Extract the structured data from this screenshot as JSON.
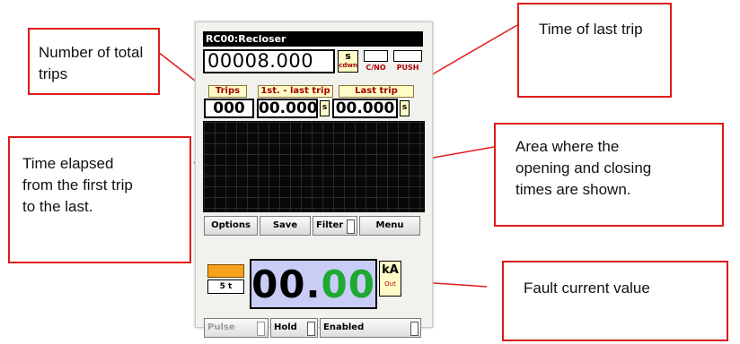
{
  "device": {
    "title": "RC00:Recloser",
    "counter_value": "00008.000",
    "counter_unit": "s",
    "counter_mode": "cdwn",
    "checkbox_labels": [
      "C/NO",
      "PUSH"
    ],
    "headers": {
      "trips": "Trips",
      "first_last": "1st. - last trip",
      "last": "Last trip"
    },
    "values": {
      "trips": "000",
      "first_last": "00.000",
      "first_last_unit": "s",
      "last": "00.000",
      "last_unit": "s"
    },
    "buttons": {
      "options": "Options",
      "save": "Save",
      "filter": "Filter",
      "menu": "Menu"
    },
    "small_value": "5 t",
    "current_digits": {
      "int": "00",
      "dot": ".",
      "frac": "00"
    },
    "current_unit": "kA",
    "current_sub": "Out",
    "bottom": {
      "pulse": "Pulse",
      "hold": "Hold",
      "enabled": "Enabled"
    }
  },
  "callouts": {
    "total_trips": "Number of total trips",
    "last_trip_time": "Time of last trip",
    "elapsed": "Time elapsed from the first trip to the last.",
    "area": "Area where the opening and closing times are shown.",
    "fault": "Fault current value"
  },
  "colors": {
    "callout_border": "#e01a1a",
    "accent_orange": "#f7a21b",
    "display_bg": "#c9cdf6",
    "digit_green": "#1fa832"
  }
}
